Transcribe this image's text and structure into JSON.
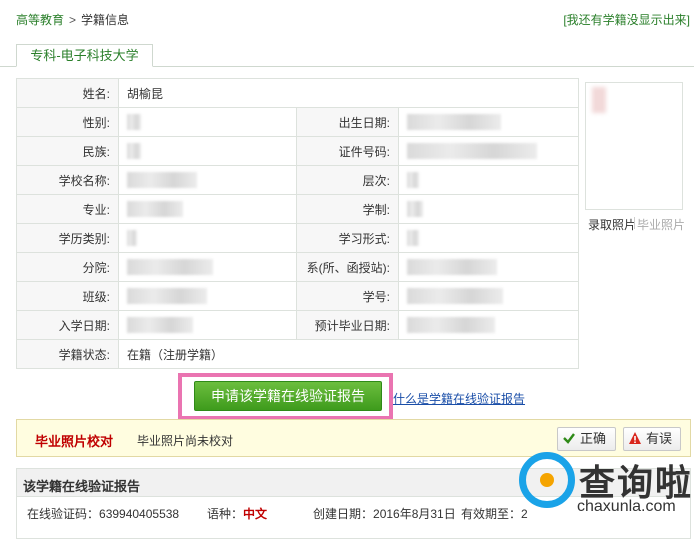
{
  "breadcrumb": {
    "home": "高等教育",
    "separator": ">",
    "current": "学籍信息"
  },
  "top_link": "[我还有学籍没显示出来]",
  "tab_label": "专科-电子科技大学",
  "info": {
    "rows": [
      {
        "l1": "姓名:",
        "v1": "胡榆昆",
        "l2": "",
        "v2": ""
      },
      {
        "l1": "性别:",
        "v1": "",
        "l2": "出生日期:",
        "v2": ""
      },
      {
        "l1": "民族:",
        "v1": "",
        "l2": "证件号码:",
        "v2": ""
      },
      {
        "l1": "学校名称:",
        "v1": "",
        "l2": "层次:",
        "v2": ""
      },
      {
        "l1": "专业:",
        "v1": "",
        "l2": "学制:",
        "v2": ""
      },
      {
        "l1": "学历类别:",
        "v1": "",
        "l2": "学习形式:",
        "v2": ""
      },
      {
        "l1": "分院:",
        "v1": "",
        "l2": "系(所、函授站):",
        "v2": ""
      },
      {
        "l1": "班级:",
        "v1": "",
        "l2": "学号:",
        "v2": ""
      },
      {
        "l1": "入学日期:",
        "v1": "",
        "l2": "预计毕业日期:",
        "v2": ""
      },
      {
        "l1": "学籍状态:",
        "v1": "在籍（注册学籍）",
        "l2": "",
        "v2": ""
      }
    ]
  },
  "photo_tabs": {
    "enroll": "录取照片",
    "graduate": "毕业照片"
  },
  "apply_button": "申请该学籍在线验证报告",
  "what_link": "什么是学籍在线验证报告",
  "photo_check": {
    "title": "毕业照片校对",
    "status": "毕业照片尚未校对",
    "correct": "正确",
    "wrong": "有误"
  },
  "report": {
    "title": "该学籍在线验证报告",
    "code_label": "在线验证码：",
    "code": "639940405538",
    "lang_label": "语种：",
    "lang": "中文",
    "created_label": "创建日期：",
    "created": "2016年8月31日",
    "valid_label": "有效期至：",
    "valid": "2"
  },
  "watermark": {
    "cn": "查询啦",
    "en": "chaxunla.com"
  },
  "colors": {
    "green": "#2a7f2a",
    "button": "#4aa625",
    "highlight": "#ea74b1",
    "red": "#c00000",
    "link": "#1a4ea8"
  }
}
